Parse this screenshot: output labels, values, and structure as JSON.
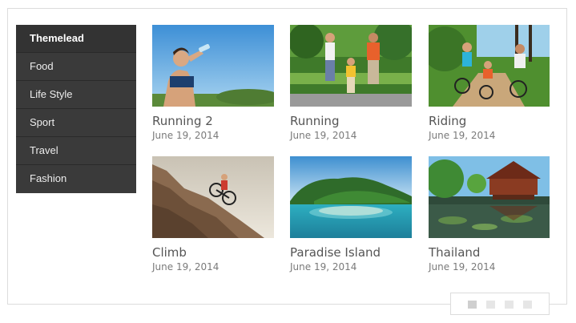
{
  "menu": {
    "items": [
      {
        "label": "Themelead",
        "active": true
      },
      {
        "label": "Food"
      },
      {
        "label": "Life Style"
      },
      {
        "label": "Sport"
      },
      {
        "label": "Travel"
      },
      {
        "label": "Fashion"
      }
    ]
  },
  "posts": [
    {
      "title": "Running 2",
      "date": "June 19, 2014"
    },
    {
      "title": "Running",
      "date": "June 19, 2014"
    },
    {
      "title": "Riding",
      "date": "June 19, 2014"
    },
    {
      "title": "Climb",
      "date": "June 19, 2014"
    },
    {
      "title": "Paradise Island",
      "date": "June 19, 2014"
    },
    {
      "title": "Thailand",
      "date": "June 19, 2014"
    }
  ],
  "pager": {
    "pages": 4,
    "active_page": 1
  }
}
